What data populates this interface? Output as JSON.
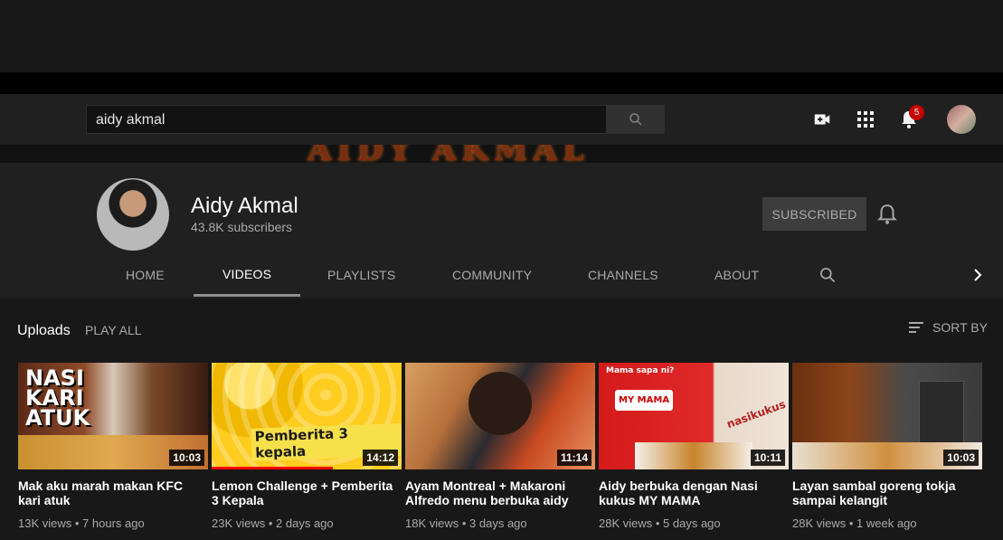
{
  "masthead": {
    "search_value": "aidy akmal",
    "notification_count": "5"
  },
  "banner": {
    "text": "AIDY AKMAL"
  },
  "channel": {
    "name": "Aidy Akmal",
    "subscribers": "43.8K subscribers",
    "subscribe_label": "SUBSCRIBED"
  },
  "tabs": [
    {
      "label": "HOME"
    },
    {
      "label": "VIDEOS"
    },
    {
      "label": "PLAYLISTS"
    },
    {
      "label": "COMMUNITY"
    },
    {
      "label": "CHANNELS"
    },
    {
      "label": "ABOUT"
    }
  ],
  "uploads": {
    "heading": "Uploads",
    "play_all": "PLAY ALL",
    "sort_by": "SORT BY"
  },
  "videos": [
    {
      "title": "Mak aku marah makan KFC kari atuk",
      "duration": "10:03",
      "views": "13K views",
      "age": "7 hours ago",
      "overlay": "NASI KARI ATUK"
    },
    {
      "title": "Lemon Challenge + Pemberita 3 Kepala",
      "duration": "14:12",
      "views": "23K views",
      "age": "2 days ago",
      "overlay": "Pemberita 3 kepala"
    },
    {
      "title": "Ayam Montreal + Makaroni Alfredo menu berbuka aidy",
      "duration": "11:14",
      "views": "18K views",
      "age": "3 days ago"
    },
    {
      "title": "Aidy berbuka dengan Nasi kukus MY MAMA",
      "duration": "10:11",
      "views": "28K views",
      "age": "5 days ago",
      "overlay": "Mama sapa ni?",
      "overlay2": "MY MAMA",
      "overlay3": "nasikukus"
    },
    {
      "title": "Layan sambal goreng tokja sampai kelangit",
      "duration": "10:03",
      "views": "28K views",
      "age": "1 week ago"
    }
  ],
  "colors": {
    "background": "#181818",
    "header": "#202020",
    "masthead": "#212121",
    "badge": "#cc0000"
  }
}
